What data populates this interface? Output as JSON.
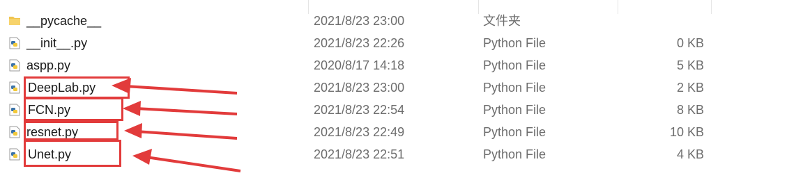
{
  "files": [
    {
      "name": "__pycache__",
      "modified": "2021/8/23 23:00",
      "type": "文件夹",
      "size": "",
      "icon": "folder-icon"
    },
    {
      "name": "__init__.py",
      "modified": "2021/8/23 22:26",
      "type": "Python File",
      "size": "0 KB",
      "icon": "python-file-icon"
    },
    {
      "name": "aspp.py",
      "modified": "2020/8/17 14:18",
      "type": "Python File",
      "size": "5 KB",
      "icon": "python-file-icon"
    },
    {
      "name": "DeepLab.py",
      "modified": "2021/8/23 23:00",
      "type": "Python File",
      "size": "2 KB",
      "icon": "python-file-icon"
    },
    {
      "name": "FCN.py",
      "modified": "2021/8/23 22:54",
      "type": "Python File",
      "size": "8 KB",
      "icon": "python-file-icon"
    },
    {
      "name": "resnet.py",
      "modified": "2021/8/23 22:49",
      "type": "Python File",
      "size": "10 KB",
      "icon": "python-file-icon"
    },
    {
      "name": "Unet.py",
      "modified": "2021/8/23 22:51",
      "type": "Python File",
      "size": "4 KB",
      "icon": "python-file-icon"
    }
  ],
  "annotation_color": "#e23b3b"
}
